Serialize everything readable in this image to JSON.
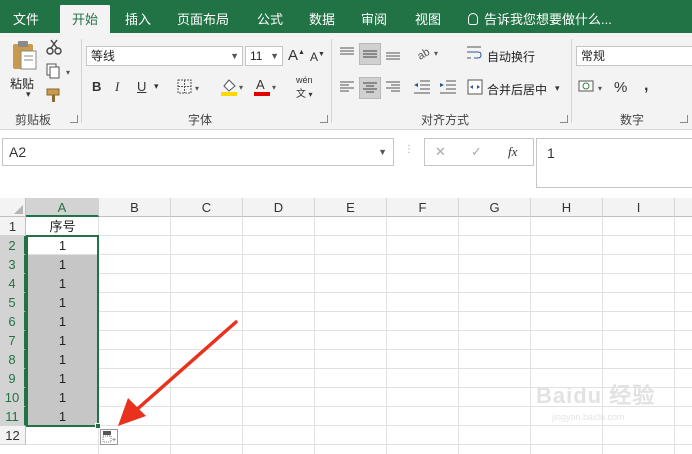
{
  "tabs": [
    {
      "label": "文件",
      "active": false
    },
    {
      "label": "开始",
      "active": true
    },
    {
      "label": "插入",
      "active": false
    },
    {
      "label": "页面布局",
      "active": false
    },
    {
      "label": "公式",
      "active": false
    },
    {
      "label": "数据",
      "active": false
    },
    {
      "label": "审阅",
      "active": false
    },
    {
      "label": "视图",
      "active": false
    }
  ],
  "tell_me": "告诉我您想要做什么...",
  "ribbon": {
    "clipboard": {
      "paste_label": "粘贴",
      "group_label": "剪贴板"
    },
    "font": {
      "font_name": "等线",
      "font_size": "11",
      "grow_label": "A",
      "shrink_label": "A",
      "bold_label": "B",
      "italic_label": "I",
      "underline_label": "U",
      "phonetic_label": "wén",
      "group_label": "字体"
    },
    "alignment": {
      "wrap_text_label": "自动换行",
      "merge_center_label": "合并后居中",
      "group_label": "对齐方式"
    },
    "number": {
      "format": "常规",
      "percent_label": "%",
      "comma_label": ",",
      "group_label": "数字"
    }
  },
  "formula_bar": {
    "name_box": "A2",
    "cancel_label": "✕",
    "enter_label": "✓",
    "fx_label": "fx",
    "formula_value": "1"
  },
  "sheet": {
    "columns": [
      "A",
      "B",
      "C",
      "D",
      "E",
      "F",
      "G",
      "H",
      "I"
    ],
    "rows": [
      "1",
      "2",
      "3",
      "4",
      "5",
      "6",
      "7",
      "8",
      "9",
      "10",
      "11",
      "12"
    ],
    "column_a_values": [
      "序号",
      "1",
      "1",
      "1",
      "1",
      "1",
      "1",
      "1",
      "1",
      "1",
      "1",
      ""
    ],
    "selected_column": "A",
    "selected_range": "A2:A11"
  },
  "colors": {
    "accent": "#217346",
    "arrow": "#e8321e"
  },
  "watermark": {
    "brand": "Baidu 经验",
    "url": "jingyan.baidu.com"
  }
}
